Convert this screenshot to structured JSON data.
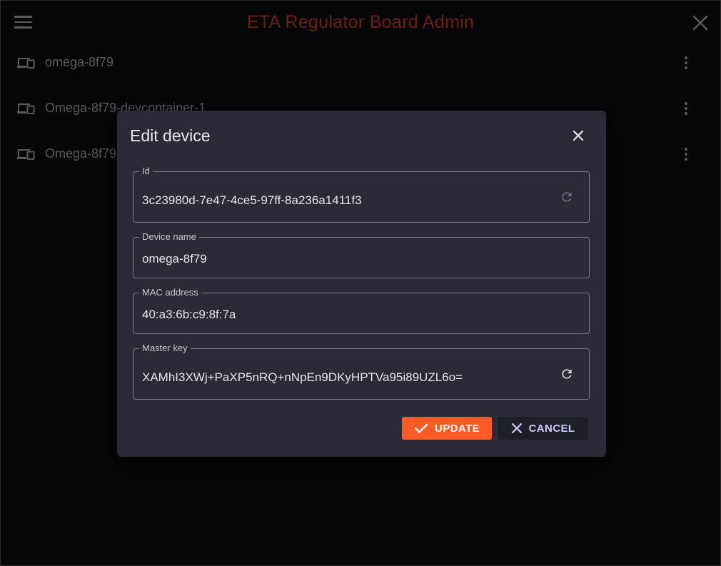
{
  "app": {
    "title": "ETA Regulator Board Admin",
    "title_color": "#a8301c"
  },
  "icons": {
    "menu": "menu-icon",
    "close": "close-icon",
    "device": "devices-icon",
    "more": "more-vert-icon",
    "refresh": "refresh-icon",
    "check": "check-icon"
  },
  "devices": [
    {
      "name": "omega-8f79"
    },
    {
      "name": "Omega-8f79-devcontainer-1"
    },
    {
      "name": "Omega-8f79"
    }
  ],
  "dialog": {
    "title": "Edit device",
    "fields": {
      "id": {
        "label": "Id",
        "value": "3c23980d-7e47-4ce5-97ff-8a236a1411f3"
      },
      "device_name": {
        "label": "Device name",
        "value": "omega-8f79"
      },
      "mac": {
        "label": "MAC address",
        "value": "40:a3:6b:c9:8f:7a"
      },
      "master_key": {
        "label": "Master key",
        "value": "XAMhI3XWj+PaXP5nRQ+nNpEn9DKyHPTVa95i89UZL6o="
      }
    },
    "update_label": "UPDATE",
    "cancel_label": "CANCEL"
  },
  "colors": {
    "accent": "#ff5a24",
    "dialog_bg": "#2b2b35",
    "cancel_text": "#c9c9ff"
  }
}
